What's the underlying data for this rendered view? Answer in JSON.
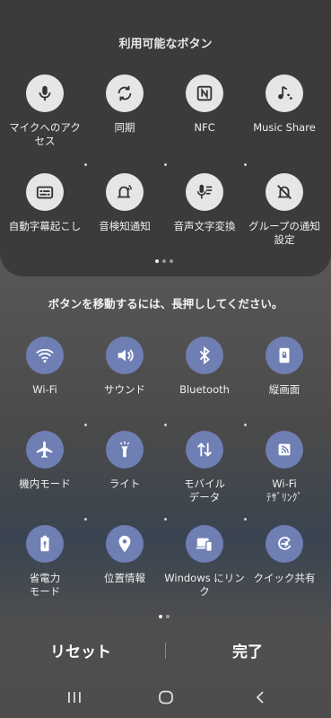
{
  "panel": {
    "title": "利用可能なボタン",
    "buttons": [
      {
        "label": "マイクへのアク\nセス",
        "icon": "mic-icon"
      },
      {
        "label": "同期",
        "icon": "sync-icon"
      },
      {
        "label": "NFC",
        "icon": "nfc-icon"
      },
      {
        "label": "Music Share",
        "icon": "music-share-icon"
      },
      {
        "label": "自動字幕起こし",
        "icon": "caption-icon"
      },
      {
        "label": "音検知通知",
        "icon": "sound-detect-icon"
      },
      {
        "label": "音声文字変換",
        "icon": "transcribe-icon"
      },
      {
        "label": "グループの通知\n設定",
        "icon": "notification-off-icon"
      }
    ]
  },
  "hint": "ボタンを移動するには、長押ししてください。",
  "active": {
    "buttons": [
      {
        "label": "Wi-Fi",
        "icon": "wifi-icon"
      },
      {
        "label": "サウンド",
        "icon": "volume-icon"
      },
      {
        "label": "Bluetooth",
        "icon": "bluetooth-icon"
      },
      {
        "label": "縦画面",
        "icon": "portrait-lock-icon"
      },
      {
        "label": "機内モード",
        "icon": "airplane-icon"
      },
      {
        "label": "ライト",
        "icon": "flashlight-icon"
      },
      {
        "label": "モバイル\nデータ",
        "icon": "mobile-data-icon"
      },
      {
        "label": "Wi-Fi\nﾃｻﾞﾘﾝｸﾞ",
        "icon": "hotspot-icon"
      },
      {
        "label": "省電力\nモード",
        "icon": "battery-saver-icon"
      },
      {
        "label": "位置情報",
        "icon": "location-icon"
      },
      {
        "label": "Windows にリン\nク",
        "icon": "link-windows-icon"
      },
      {
        "label": "クイック共有",
        "icon": "quick-share-icon"
      }
    ]
  },
  "footer": {
    "reset": "リセット",
    "done": "完了"
  },
  "colors": {
    "panel_bg": "#3b3b3b",
    "inactive_circle": "#e6e6e6",
    "active_circle": "#6f7fb4"
  }
}
